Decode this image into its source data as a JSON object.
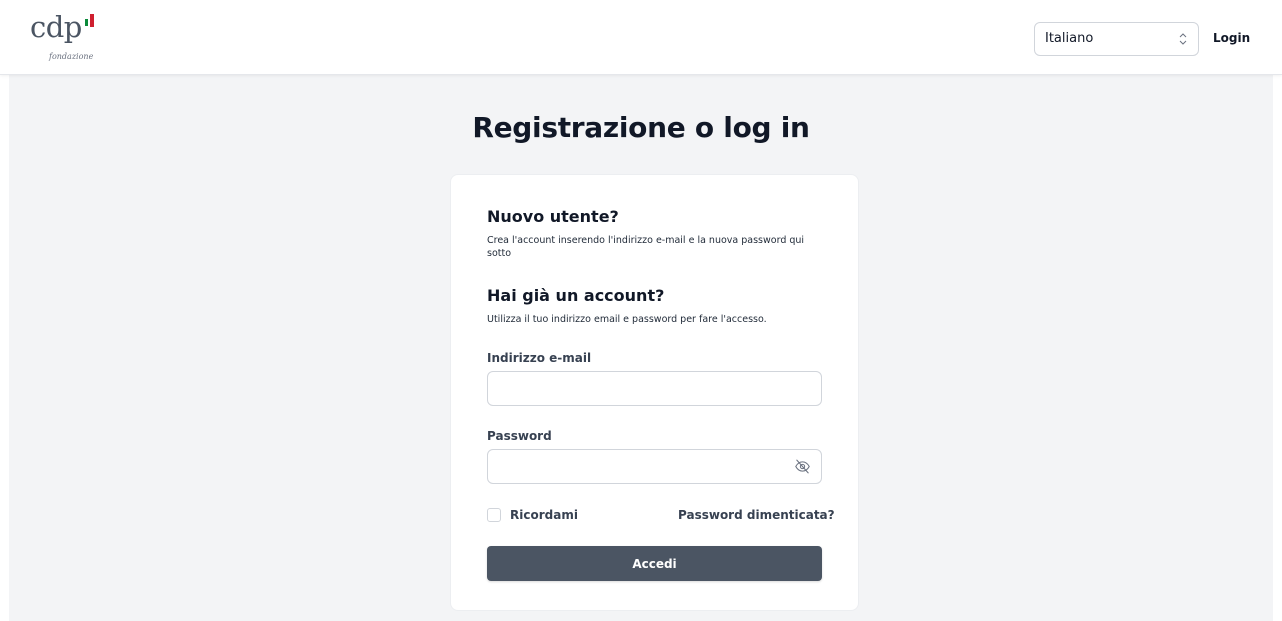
{
  "header": {
    "logo_text": "cdp",
    "logo_subtext": "fondazione",
    "language_selected": "Italiano",
    "login_label": "Login"
  },
  "main": {
    "title": "Registrazione o log in"
  },
  "card": {
    "new_user_heading": "Nuovo utente?",
    "new_user_text": "Crea l'account inserendo l'indirizzo e-mail e la nuova password qui sotto",
    "have_account_heading": "Hai già un account?",
    "have_account_text": "Utilizza il tuo indirizzo email e password per fare l'accesso.",
    "email_label": "Indirizzo e-mail",
    "email_value": "",
    "password_label": "Password",
    "password_value": "",
    "remember_label": "Ricordami",
    "forgot_label": "Password dimenticata?",
    "submit_label": "Accedi"
  },
  "colors": {
    "button_bg": "#4b5563",
    "page_bg": "#f3f4f6",
    "flag_green": "#0b8a3a",
    "flag_red": "#cf1f2f"
  },
  "icons": {
    "eye": "eye-off-icon",
    "select": "chevron-updown-icon"
  }
}
